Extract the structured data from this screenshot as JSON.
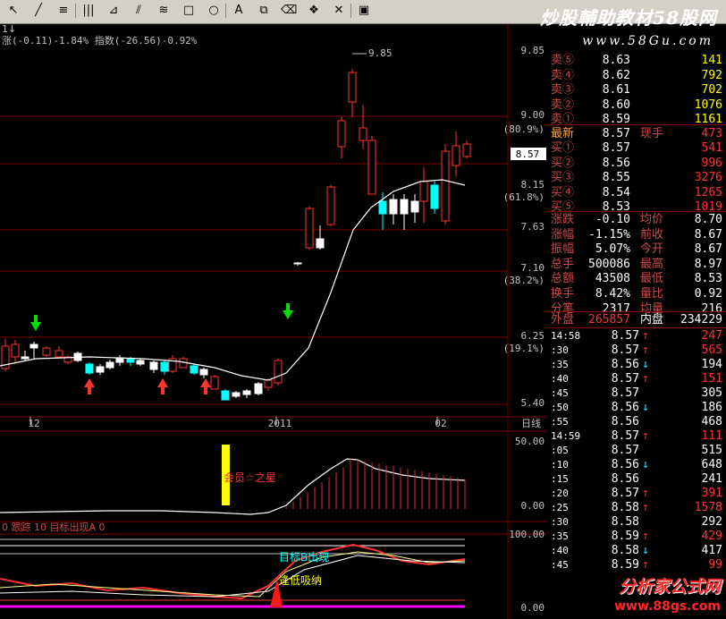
{
  "brand": {
    "title": "炒股輔助教材58股网",
    "url": "www.58Gu.com"
  },
  "footer_logo": {
    "name": "分析家公式网",
    "url": "www.88gs.com"
  },
  "toolbar": {
    "items": [
      "cursor",
      "line",
      "hline",
      "vlines",
      "fan",
      "parallel",
      "channel",
      "rect",
      "ellipse",
      "text",
      "copy",
      "erase",
      "palette",
      "delete",
      "save"
    ]
  },
  "chart_header": {
    "change": "涨(-0.11)-1.84%",
    "index": "指数(-26.56)-0.92%"
  },
  "price_axis": {
    "labels": [
      "9.85",
      "9.00",
      "8.57",
      "8.15",
      "7.63",
      "7.10",
      "6.25",
      "5.40"
    ],
    "percents": [
      "(80.9%)",
      "(61.8%)",
      "(38.2%)",
      "(19.1%)"
    ],
    "current": "8.57",
    "peak_label": "9.85"
  },
  "date_axis": {
    "labels": [
      "12",
      "2011",
      "02"
    ],
    "period": "日线"
  },
  "sub1": {
    "labels": [
      "50.00",
      "0.00"
    ],
    "annotation": "会员☆之星"
  },
  "sub2": {
    "legend": [
      "0",
      "跟踪",
      "10",
      "目标出现A",
      "0"
    ],
    "labels": [
      "100.00",
      "0.00"
    ],
    "annotations": [
      "目标B出现",
      "逢低吸纳"
    ]
  },
  "orderbook": {
    "asks": [
      {
        "label": "卖⑤",
        "price": "8.63",
        "vol": "141"
      },
      {
        "label": "卖④",
        "price": "8.62",
        "vol": "792"
      },
      {
        "label": "卖③",
        "price": "8.61",
        "vol": "702"
      },
      {
        "label": "卖②",
        "price": "8.60",
        "vol": "1076"
      },
      {
        "label": "卖①",
        "price": "8.59",
        "vol": "1161"
      }
    ],
    "last": {
      "label": "最新",
      "price": "8.57",
      "label2": "现手",
      "vol": "473"
    },
    "bids": [
      {
        "label": "买①",
        "price": "8.57",
        "vol": "541"
      },
      {
        "label": "买②",
        "price": "8.56",
        "vol": "996"
      },
      {
        "label": "买③",
        "price": "8.55",
        "vol": "3276"
      },
      {
        "label": "买④",
        "price": "8.54",
        "vol": "1265"
      },
      {
        "label": "买⑤",
        "price": "8.53",
        "vol": "1019"
      }
    ]
  },
  "stats": [
    {
      "l1": "涨跌",
      "v1": "-0.10",
      "l2": "均价",
      "v2": "8.70"
    },
    {
      "l1": "涨幅",
      "v1": "-1.15%",
      "l2": "前收",
      "v2": "8.67"
    },
    {
      "l1": "振幅",
      "v1": "5.07%",
      "l2": "今开",
      "v2": "8.67"
    },
    {
      "l1": "总手",
      "v1": "500086",
      "l2": "最高",
      "v2": "8.97"
    },
    {
      "l1": "总额",
      "v1": "43508",
      "l2": "最低",
      "v2": "8.53"
    },
    {
      "l1": "换手",
      "v1": "8.42%",
      "l2": "量比",
      "v2": "0.92"
    },
    {
      "l1": "分笔",
      "v1": "2317",
      "l2": "均量",
      "v2": "216"
    }
  ],
  "outer_inner": {
    "l1": "外盘",
    "v1": "265857",
    "l2": "内盘",
    "v2": "234229"
  },
  "ticks": [
    {
      "t": "14:58",
      "p": "8.57",
      "d": "up",
      "v": "247"
    },
    {
      "t": ":30",
      "p": "8.57",
      "d": "up",
      "v": "565"
    },
    {
      "t": ":35",
      "p": "8.56",
      "d": "down",
      "v": "194"
    },
    {
      "t": ":40",
      "p": "8.57",
      "d": "up",
      "v": "151"
    },
    {
      "t": ":45",
      "p": "8.57",
      "d": "",
      "v": "305"
    },
    {
      "t": ":50",
      "p": "8.56",
      "d": "down",
      "v": "186"
    },
    {
      "t": ":55",
      "p": "8.56",
      "d": "",
      "v": "468"
    },
    {
      "t": "14:59",
      "p": "8.57",
      "d": "up",
      "v": "111"
    },
    {
      "t": ":05",
      "p": "8.57",
      "d": "",
      "v": "515"
    },
    {
      "t": ":10",
      "p": "8.56",
      "d": "down",
      "v": "648"
    },
    {
      "t": ":15",
      "p": "8.56",
      "d": "",
      "v": "241"
    },
    {
      "t": ":20",
      "p": "8.57",
      "d": "up",
      "v": "391"
    },
    {
      "t": ":25",
      "p": "8.58",
      "d": "up",
      "v": "1578"
    },
    {
      "t": ":30",
      "p": "8.58",
      "d": "",
      "v": "292"
    },
    {
      "t": ":35",
      "p": "8.59",
      "d": "up",
      "v": "429"
    },
    {
      "t": ":40",
      "p": "8.58",
      "d": "down",
      "v": "417"
    },
    {
      "t": ":45",
      "p": "8.59",
      "d": "up",
      "v": "99"
    }
  ],
  "colors": {
    "up": "#ff3232",
    "down": "#00ffff",
    "ma": "#ffffff",
    "grid": "#800000",
    "bg": "#000000"
  }
}
